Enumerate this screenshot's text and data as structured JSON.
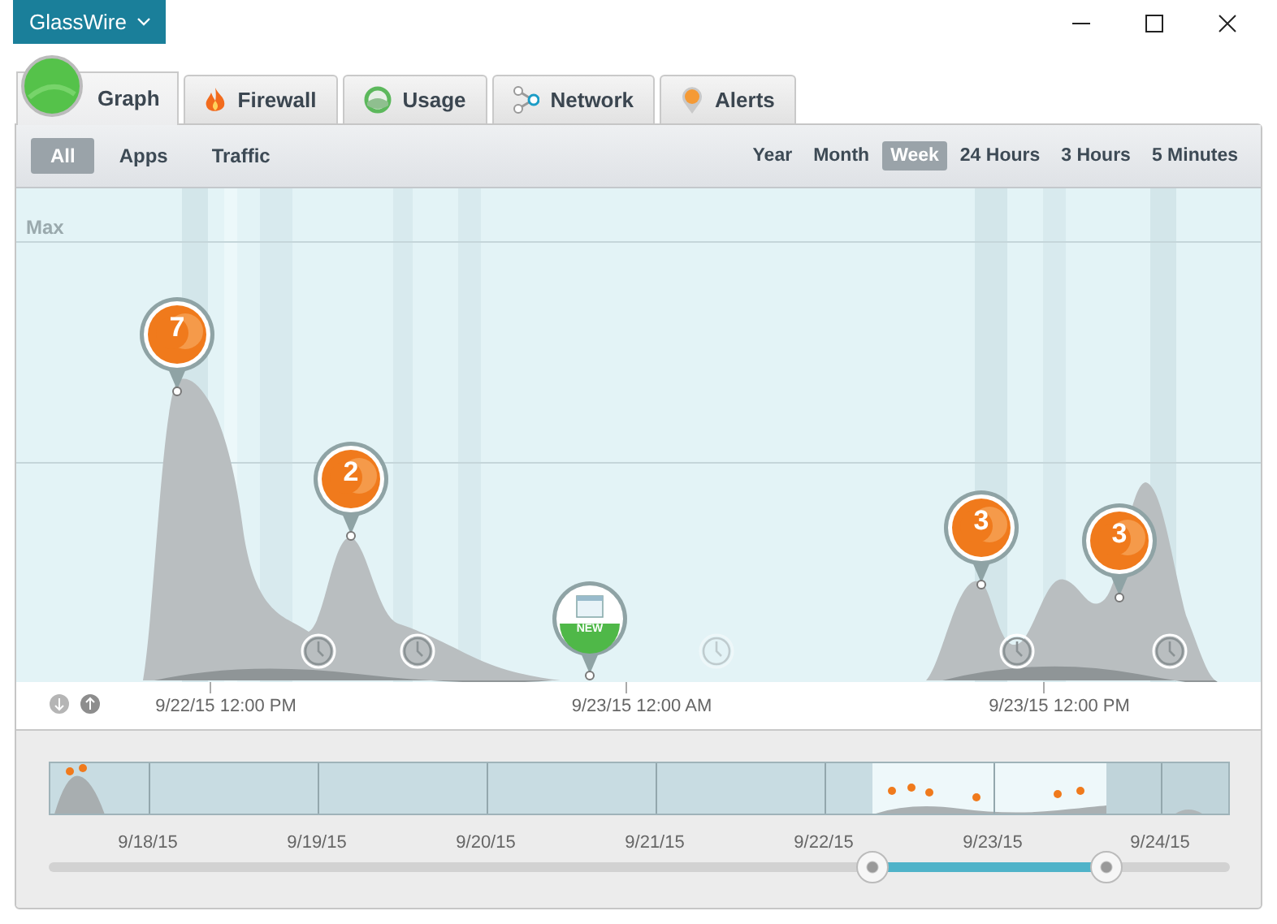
{
  "app_menu": {
    "label": "GlassWire"
  },
  "tabs": [
    {
      "label": "Graph",
      "selected": true
    },
    {
      "label": "Firewall",
      "selected": false
    },
    {
      "label": "Usage",
      "selected": false
    },
    {
      "label": "Network",
      "selected": false
    },
    {
      "label": "Alerts",
      "selected": false
    }
  ],
  "filters": [
    {
      "label": "All",
      "selected": true
    },
    {
      "label": "Apps",
      "selected": false
    },
    {
      "label": "Traffic",
      "selected": false
    }
  ],
  "ranges": [
    {
      "label": "Year",
      "selected": false
    },
    {
      "label": "Month",
      "selected": false
    },
    {
      "label": "Week",
      "selected": true
    },
    {
      "label": "24 Hours",
      "selected": false
    },
    {
      "label": "3 Hours",
      "selected": false
    },
    {
      "label": "5 Minutes",
      "selected": false
    }
  ],
  "graph": {
    "max_label": "Max",
    "markers": [
      {
        "kind": "count",
        "text": "7"
      },
      {
        "kind": "count",
        "text": "2"
      },
      {
        "kind": "new",
        "text": "NEW"
      },
      {
        "kind": "count",
        "text": "3"
      },
      {
        "kind": "count",
        "text": "3"
      }
    ],
    "clocks": [
      {
        "faded": false
      },
      {
        "faded": false
      },
      {
        "faded": true
      },
      {
        "faded": false
      },
      {
        "faded": false
      }
    ]
  },
  "timeline": {
    "labels": [
      "9/22/15 12:00 PM",
      "9/23/15 12:00 AM",
      "9/23/15 12:00 PM"
    ]
  },
  "overview": {
    "dates": [
      "9/18/15",
      "9/19/15",
      "9/20/15",
      "9/21/15",
      "9/22/15",
      "9/23/15",
      "9/24/15"
    ],
    "range": [
      {
        "level": 0.697
      },
      {
        "level": 0.895
      }
    ]
  }
}
